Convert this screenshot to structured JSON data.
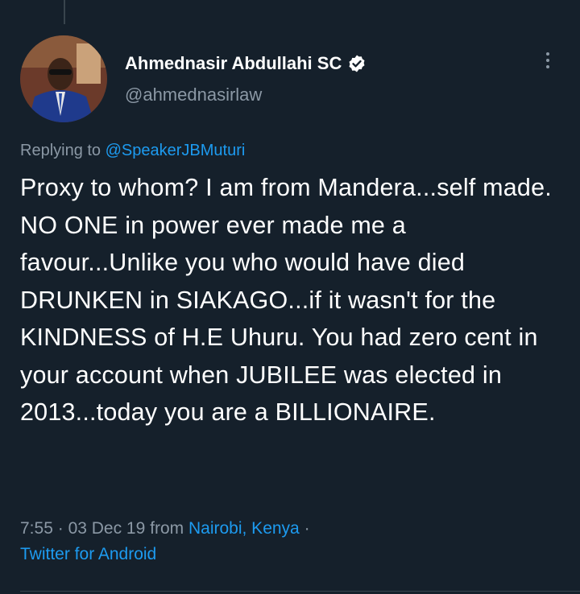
{
  "tweet": {
    "author_name": "Ahmednasir Abdullahi SC",
    "author_handle": "@ahmednasirlaw",
    "replying_prefix": "Replying to",
    "replying_to": "@SpeakerJBMuturi",
    "text": "Proxy to whom? I am from Mandera...self made. NO ONE in power ever made me a favour...Unlike you who would have died DRUNKEN in SIAKAGO...if it wasn't for the KINDNESS of H.E Uhuru. You had zero cent in your account when JUBILEE was elected in 2013...today you are a BILLIONAIRE.",
    "time": "7:55",
    "separator": "·",
    "date": "03 Dec 19",
    "from_prefix": "from",
    "location": "Nairobi, Kenya",
    "source": "Twitter for Android"
  },
  "icons": {
    "verified": "verified-badge-icon",
    "more": "more-options-icon"
  },
  "colors": {
    "background": "#15202b",
    "link": "#1d9bf0",
    "secondary_text": "#8b98a5",
    "primary_text": "#ffffff"
  }
}
